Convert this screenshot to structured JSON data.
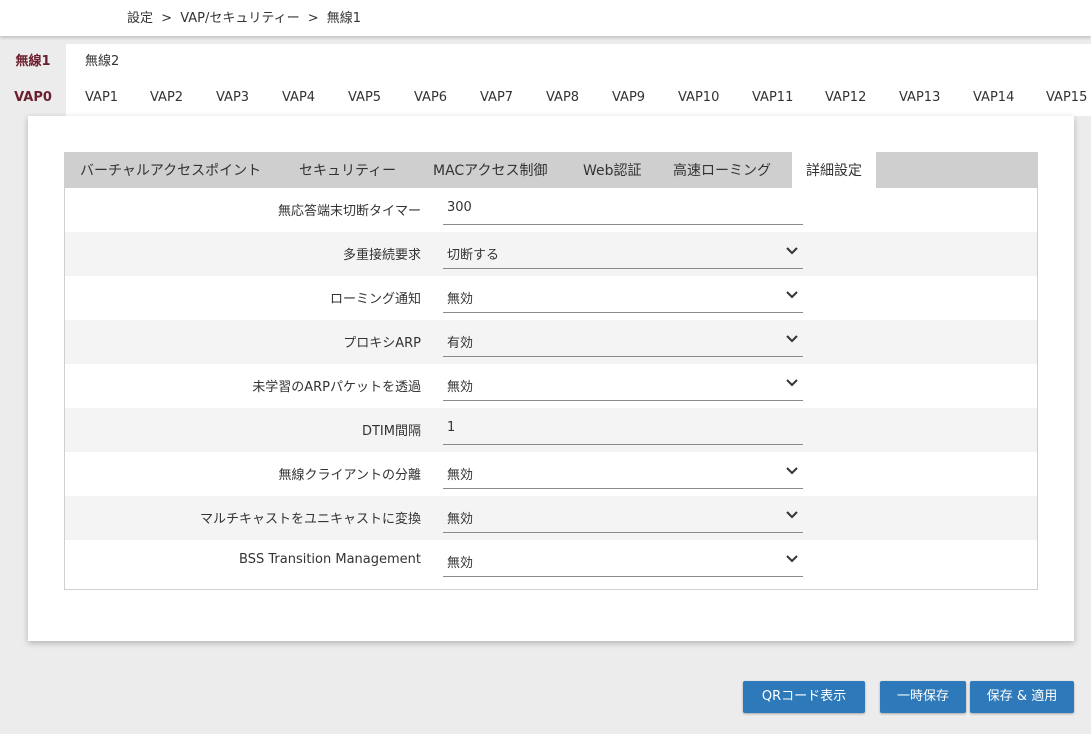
{
  "breadcrumb": {
    "items": [
      "設定",
      ">",
      "VAP/セキュリティー",
      ">",
      "無線1"
    ]
  },
  "radio_tabs": [
    "無線1",
    "無線2"
  ],
  "vap_tabs": [
    "VAP0",
    "VAP1",
    "VAP2",
    "VAP3",
    "VAP4",
    "VAP5",
    "VAP6",
    "VAP7",
    "VAP8",
    "VAP9",
    "VAP10",
    "VAP11",
    "VAP12",
    "VAP13",
    "VAP14",
    "VAP15"
  ],
  "section_tabs": [
    "バーチャルアクセスポイント",
    "セキュリティー",
    "MACアクセス制御",
    "Web認証",
    "高速ローミング",
    "詳細設定"
  ],
  "settings": [
    {
      "label": "無応答端末切断タイマー",
      "value": "300",
      "type": "text"
    },
    {
      "label": "多重接続要求",
      "value": "切断する",
      "type": "select"
    },
    {
      "label": "ローミング通知",
      "value": "無効",
      "type": "select"
    },
    {
      "label": "プロキシARP",
      "value": "有効",
      "type": "select"
    },
    {
      "label": "未学習のARPパケットを透過",
      "value": "無効",
      "type": "select"
    },
    {
      "label": "DTIM間隔",
      "value": "1",
      "type": "text"
    },
    {
      "label": "無線クライアントの分離",
      "value": "無効",
      "type": "select"
    },
    {
      "label": "マルチキャストをユニキャストに変換",
      "value": "無効",
      "type": "select"
    },
    {
      "label": "BSS Transition Management",
      "value": "無効",
      "type": "select"
    }
  ],
  "buttons": {
    "qr": "QRコード表示",
    "temp_save": "一時保存",
    "save_apply": "保存 & 適用"
  },
  "colors": {
    "accent": "#6a1f2e",
    "button": "#2e79ba",
    "background": "#ececec"
  }
}
